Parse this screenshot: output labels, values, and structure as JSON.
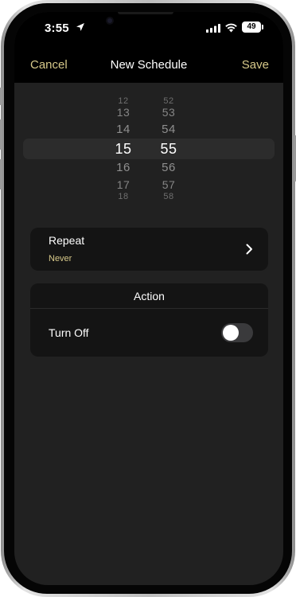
{
  "status_bar": {
    "time": "3:55",
    "battery": "49"
  },
  "nav": {
    "cancel": "Cancel",
    "title": "New Schedule",
    "save": "Save"
  },
  "time_picker": {
    "hours": [
      "12",
      "13",
      "14",
      "15",
      "16",
      "17",
      "18"
    ],
    "minutes": [
      "52",
      "53",
      "54",
      "55",
      "56",
      "57",
      "58"
    ],
    "selected_hour": "15",
    "selected_minute": "55"
  },
  "repeat": {
    "label": "Repeat",
    "value": "Never"
  },
  "action": {
    "header": "Action",
    "turn_off_label": "Turn Off",
    "turn_off_enabled": false
  },
  "colors": {
    "accent": "#d7c98a",
    "background": "#212121",
    "card": "#141414",
    "bar": "#000000"
  },
  "icons": {
    "location": "location-arrow-icon",
    "signal": "cellular-signal-icon",
    "wifi": "wifi-icon",
    "chevron": "chevron-right-icon"
  }
}
